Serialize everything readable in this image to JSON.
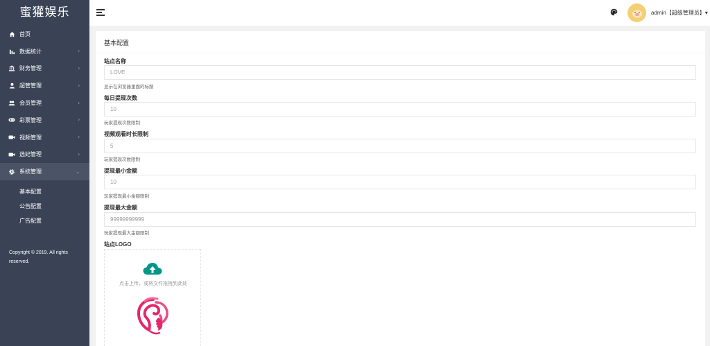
{
  "sidebar": {
    "brand": "蜜獾娱乐",
    "items": [
      {
        "label": "首页",
        "icon": "home-icon",
        "arrow": ""
      },
      {
        "label": "数据统计",
        "icon": "bar-chart-icon",
        "arrow": "›"
      },
      {
        "label": "财务管理",
        "icon": "bank-icon",
        "arrow": "›"
      },
      {
        "label": "超管管理",
        "icon": "user-icon",
        "arrow": "›"
      },
      {
        "label": "会员管理",
        "icon": "users-icon",
        "arrow": "›"
      },
      {
        "label": "彩票管理",
        "icon": "gamepad-icon",
        "arrow": "›"
      },
      {
        "label": "视频管理",
        "icon": "video-icon",
        "arrow": "›"
      },
      {
        "label": "选妃管理",
        "icon": "video-icon",
        "arrow": "›"
      },
      {
        "label": "系统管理",
        "icon": "gear-icon",
        "arrow": "⌄"
      }
    ],
    "submenu": [
      "基本配置",
      "公告配置",
      "广告配置"
    ],
    "copyright": "Copyright © 2019. All rights reserved."
  },
  "header": {
    "user_label": "admin【超级管理员】▾"
  },
  "main": {
    "title": "基本配置",
    "fields": [
      {
        "label": "站点名称",
        "value": "LOVE",
        "hint": "显示在浏览器里面的标题"
      },
      {
        "label": "每日提现次数",
        "value": "10",
        "hint": "玩家提现次数限制"
      },
      {
        "label": "视频观看时长限制",
        "value": "5",
        "hint": "玩家提现次数限制"
      },
      {
        "label": "提现最小金额",
        "value": "10",
        "hint": "玩家提现最小金额限制"
      },
      {
        "label": "提现最大金额",
        "value": "99999999999",
        "hint": "玩家提现最大金额限制"
      }
    ],
    "logo_label": "站点LOGO",
    "upload_text": "点击上传，或将文件拖拽到此处"
  },
  "colors": {
    "sidebar_bg": "#3a4356",
    "accent": "#009688",
    "avatar_bg": "#f4cf74"
  }
}
